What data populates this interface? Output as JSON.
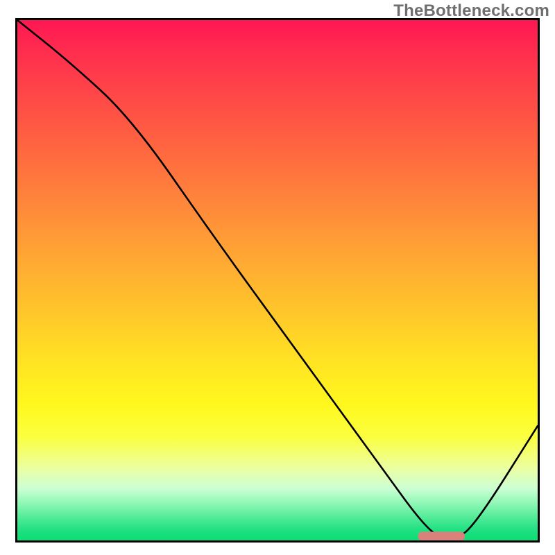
{
  "watermark": "TheBottleneck.com",
  "chart_data": {
    "type": "line",
    "title": "",
    "xlabel": "",
    "ylabel": "",
    "xlim": [
      0,
      100
    ],
    "ylim": [
      0,
      100
    ],
    "background_gradient": {
      "top": "#ff1753",
      "mid_upper": "#ff893a",
      "mid": "#ffe423",
      "mid_lower": "#fbff3e",
      "bottom": "#0edc74"
    },
    "series": [
      {
        "name": "bottleneck-curve",
        "x": [
          0,
          10,
          22,
          38,
          54,
          70,
          78,
          82,
          84,
          88,
          100
        ],
        "values": [
          100,
          92,
          81,
          58,
          36,
          14,
          3,
          0,
          0,
          3,
          22
        ]
      }
    ],
    "marker": {
      "name": "optimal-range",
      "x_start": 77,
      "x_end": 86,
      "y": 0.8,
      "color": "#d9817a"
    },
    "grid": false,
    "legend": false
  }
}
